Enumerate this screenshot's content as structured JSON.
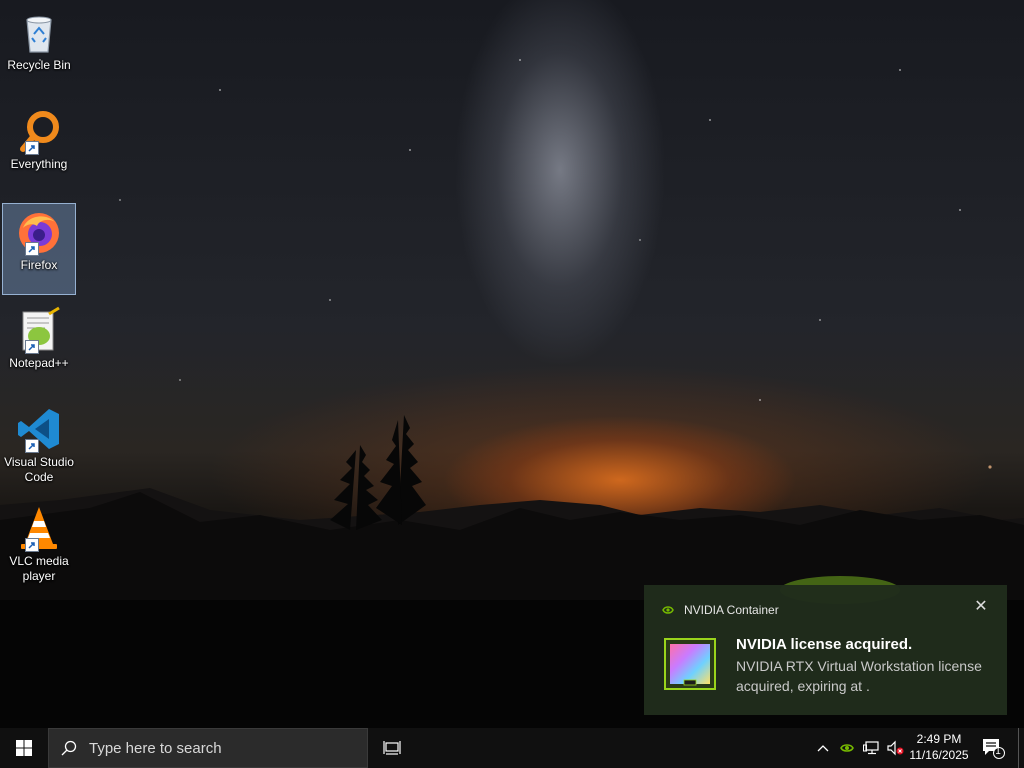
{
  "desktop": {
    "icons": [
      {
        "label": "Recycle Bin",
        "icon": "recycle-bin-icon"
      },
      {
        "label": "Everything",
        "icon": "everything-search-icon"
      },
      {
        "label": "Firefox",
        "icon": "firefox-icon"
      },
      {
        "label": "Notepad++",
        "icon": "notepad-plus-plus-icon"
      },
      {
        "label": "Visual Studio Code",
        "icon": "vscode-icon"
      },
      {
        "label": "VLC media player",
        "icon": "vlc-icon"
      }
    ],
    "selected_icon": "Firefox"
  },
  "notification": {
    "app_name": "NVIDIA Container",
    "title": "NVIDIA license acquired.",
    "body": "NVIDIA RTX Virtual Workstation license acquired, expiring at .",
    "close_icon": "close-icon",
    "accent_color": "#76b900"
  },
  "taskbar": {
    "search_placeholder": "Type here to search",
    "clock_time": "2:49 PM",
    "clock_date": "11/16/2025",
    "notification_count": "1",
    "tray_icons": [
      "chevron-up-icon",
      "nvidia-icon",
      "network-icon",
      "volume-muted-icon"
    ]
  }
}
